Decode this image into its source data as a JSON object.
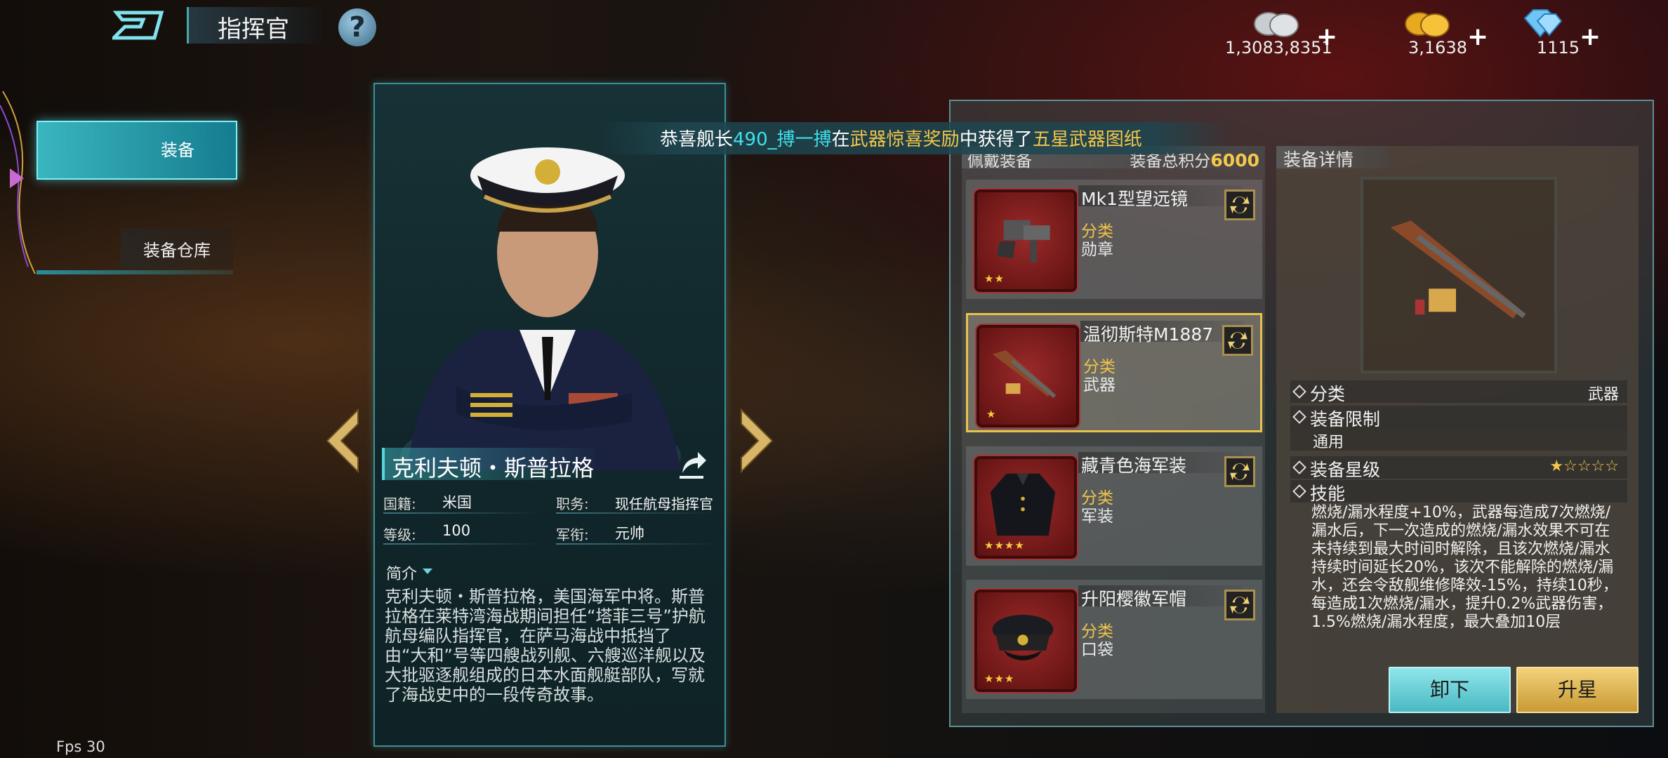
{
  "header": {
    "title": "指挥官",
    "help_icon": "question-icon"
  },
  "resources": [
    {
      "name": "silver",
      "value": "1,3083,8351",
      "plus": "+"
    },
    {
      "name": "gold",
      "value": "3,1638",
      "plus": "+"
    },
    {
      "name": "diamond",
      "value": "1115",
      "plus": "+"
    }
  ],
  "left_tabs": {
    "equip": "装备",
    "warehouse": "装备仓库"
  },
  "fps": "Fps 30",
  "commander": {
    "name": "克利夫顿・斯普拉格",
    "nationality_label": "国籍:",
    "nationality": "米国",
    "position_label": "职务:",
    "position": "现任航母指挥官",
    "level_label": "等级:",
    "level": "100",
    "rank_label": "军衔:",
    "rank": "元帅",
    "intro_label": "简介",
    "intro": "克利夫顿・斯普拉格，美国海军中将。斯普拉格在莱特湾海战期间担任“塔菲三号”护航航母编队指挥官，在萨马海战中抵挡了由“大和”号等四艘战列舰、六艘巡洋舰以及大批驱逐舰组成的日本水面舰艇部队，写就了海战史中的一段传奇故事。"
  },
  "broadcast": {
    "p1": "恭喜舰长",
    "player": "490_搏一搏",
    "p2": "在",
    "event": "武器惊喜奖励",
    "p3": "中获得了",
    "reward": "五星武器图纸"
  },
  "equipment": {
    "header_left": "佩戴装备",
    "header_right_label": "装备总积分",
    "total_score": "6000",
    "category_label": "分类",
    "items": [
      {
        "name": "Mk1型望远镜",
        "category": "勋章",
        "stars": "★★",
        "icon": "binoculars-icon"
      },
      {
        "name": "温彻斯特M1887",
        "category": "武器",
        "stars": "★",
        "icon": "shotgun-icon"
      },
      {
        "name": "藏青色海军装",
        "category": "军装",
        "stars": "★★★★",
        "icon": "navy-uniform-icon"
      },
      {
        "name": "升阳樱徽军帽",
        "category": "口袋",
        "stars": "★★★",
        "icon": "officer-cap-icon"
      }
    ]
  },
  "detail": {
    "title": "装备详情",
    "category_label": "分类",
    "category": "武器",
    "limit_label": "装备限制",
    "limit": "通用",
    "star_label": "装备星级",
    "star_value": "★☆☆☆☆",
    "skill_label": "技能",
    "skill_text": "燃烧/漏水程度+10%，武器每造成7次燃烧/漏水后，下一次造成的燃烧/漏水效果不可在未持续到最大时间时解除，且该次燃烧/漏水持续时间延长20%，该次不能解除的燃烧/漏水，还会令敌舰维修降效-15%，持续10秒，每造成1次燃烧/漏水，提升0.2%武器伤害，1.5%燃烧/漏水程度，最大叠加10层",
    "btn_unequip": "卸下",
    "btn_upstar": "升星"
  },
  "colors": {
    "accent_cyan": "#3fe0ea",
    "gold": "#f2c64a",
    "card_border": "#3a8f96"
  }
}
